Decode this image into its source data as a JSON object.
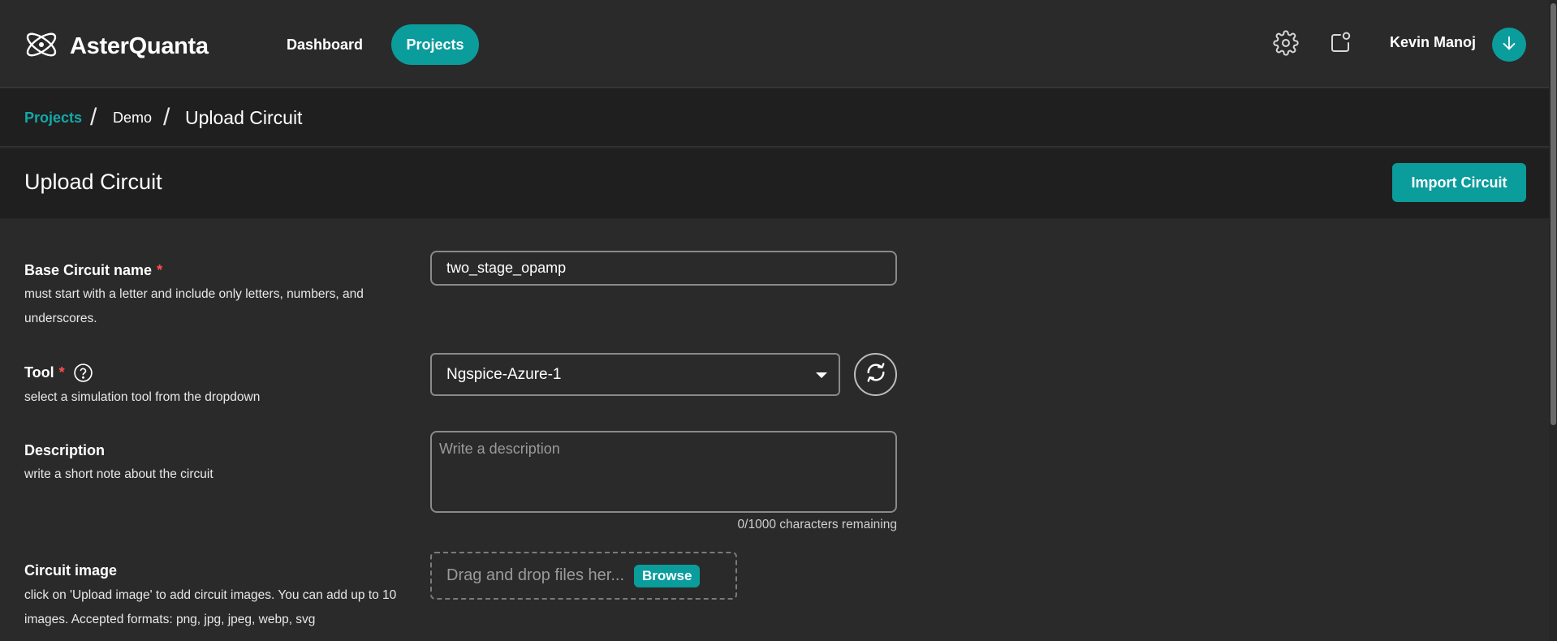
{
  "app": {
    "name": "AsterQuanta"
  },
  "nav": {
    "dashboard": "Dashboard",
    "projects": "Projects"
  },
  "user": {
    "name": "Kevin Manoj"
  },
  "breadcrumb": {
    "projects": "Projects",
    "sep": "/",
    "demo": "Demo",
    "current": "Upload Circuit"
  },
  "page": {
    "title": "Upload Circuit",
    "import_button": "Import Circuit"
  },
  "form": {
    "base_name": {
      "label": "Base Circuit name",
      "required_mark": "*",
      "help": "must start with a letter and include only letters, numbers, and underscores.",
      "value": "two_stage_opamp"
    },
    "tool": {
      "label": "Tool",
      "required_mark": "*",
      "help": "select a simulation tool from the dropdown",
      "selected": "Ngspice-Azure-1"
    },
    "description": {
      "label": "Description",
      "help": "write a short note about the circuit",
      "placeholder": "Write a description",
      "char_count": "0/1000 characters remaining"
    },
    "circuit_image": {
      "label": "Circuit image",
      "help": "click on 'Upload image' to add circuit images. You can add up to 10 images. Accepted formats: png, jpg, jpeg, webp, svg",
      "dropzone_text": "Drag and drop files her...",
      "browse_label": "Browse"
    }
  },
  "colors": {
    "accent": "#0b9c9c",
    "background": "#2a2a2a",
    "panel": "#1f1f1f",
    "required": "#ff4d4d"
  },
  "icons": [
    "atom-logo-icon",
    "gear-icon",
    "notification-icon",
    "download-arrow-icon",
    "help-circle-icon",
    "refresh-icon",
    "chevron-down-icon"
  ]
}
